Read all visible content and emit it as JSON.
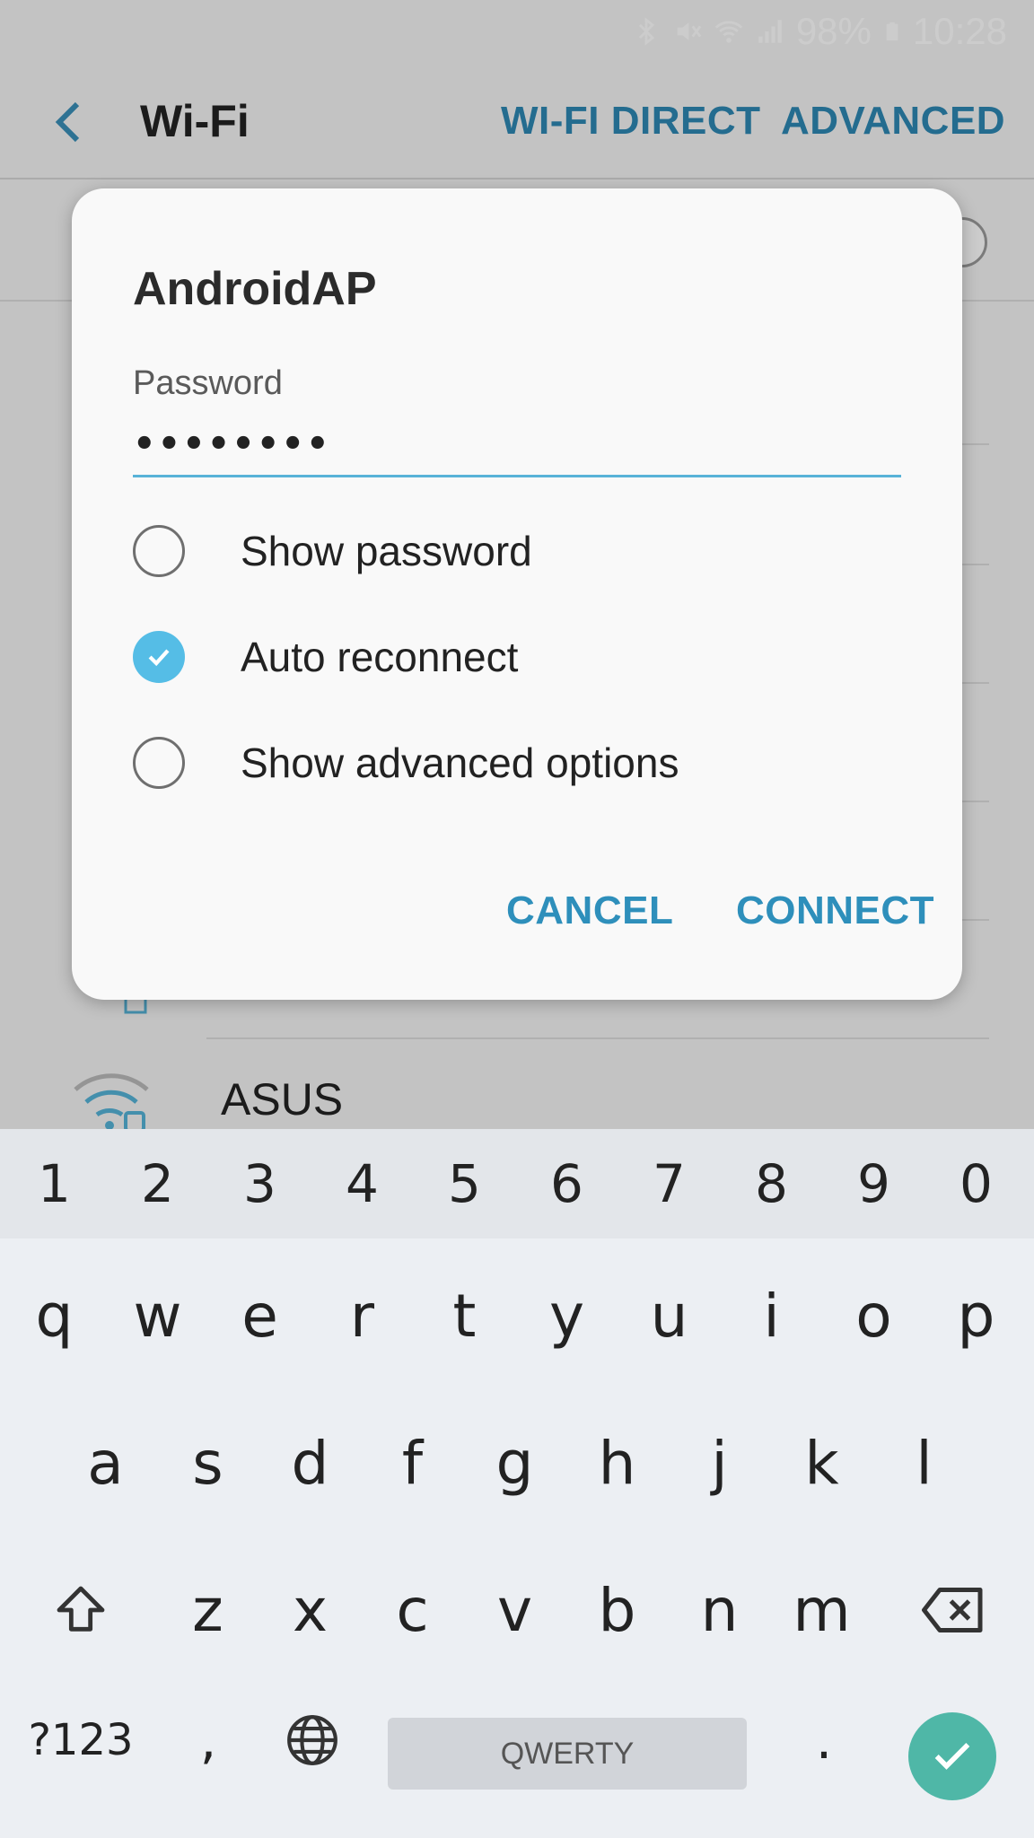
{
  "status_bar": {
    "battery": "98%",
    "time": "10:28"
  },
  "app_bar": {
    "title": "Wi-Fi",
    "wifi_direct": "WI-FI DIRECT",
    "advanced": "ADVANCED"
  },
  "network_list": {
    "visible_network": "ASUS"
  },
  "dialog": {
    "title": "AndroidAP",
    "password_label": "Password",
    "password_value": "••••••••",
    "options": [
      {
        "label": "Show password",
        "checked": false
      },
      {
        "label": "Auto reconnect",
        "checked": true
      },
      {
        "label": "Show advanced options",
        "checked": false
      }
    ],
    "cancel": "CANCEL",
    "connect": "CONNECT"
  },
  "keyboard": {
    "numbers": [
      "1",
      "2",
      "3",
      "4",
      "5",
      "6",
      "7",
      "8",
      "9",
      "0"
    ],
    "row1": [
      "q",
      "w",
      "e",
      "r",
      "t",
      "y",
      "u",
      "i",
      "o",
      "p"
    ],
    "row2": [
      "a",
      "s",
      "d",
      "f",
      "g",
      "h",
      "j",
      "k",
      "l"
    ],
    "row3": [
      "z",
      "x",
      "c",
      "v",
      "b",
      "n",
      "m"
    ],
    "symbols_key": "?123",
    "comma": ",",
    "space_label": "QWERTY",
    "period": "."
  },
  "colors": {
    "accent": "#2e8fbb",
    "checked": "#55bde6",
    "done_key": "#4fb7a7"
  }
}
